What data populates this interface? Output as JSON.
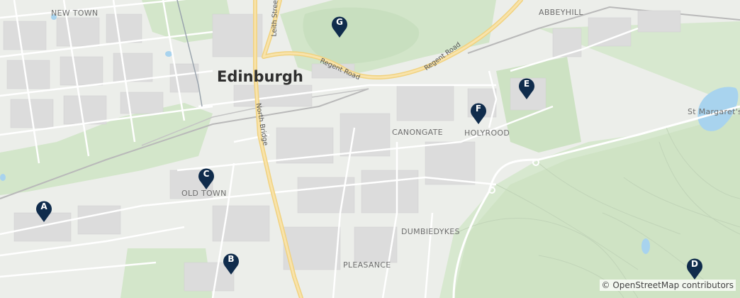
{
  "map": {
    "city_label": "Edinburgh",
    "area_labels": {
      "new_town": "NEW TOWN",
      "abbeyhill": "ABBEYHILL",
      "canongate": "CANONGATE",
      "holyrood": "HOLYROOD",
      "old_town": "OLD TOWN",
      "dumbiedykes": "DUMBIEDYKES",
      "pleasance": "PLEASANCE",
      "st_margarets": "St Margaret's Lo"
    },
    "road_labels": {
      "leith_street": "Leith Street",
      "north_bridge": "North Bridge",
      "regent_road_1": "Regent Road",
      "regent_road_2": "Regent Road"
    },
    "markers": [
      {
        "letter": "A"
      },
      {
        "letter": "B"
      },
      {
        "letter": "C"
      },
      {
        "letter": "D"
      },
      {
        "letter": "E"
      },
      {
        "letter": "F"
      },
      {
        "letter": "G"
      }
    ],
    "attribution": "© OpenStreetMap contributors",
    "colors": {
      "marker": "#102c4c",
      "water": "#a8d3ee",
      "park": "#cfe3c6",
      "main_road": "#f6d894",
      "building": "#dcdcdc"
    }
  }
}
